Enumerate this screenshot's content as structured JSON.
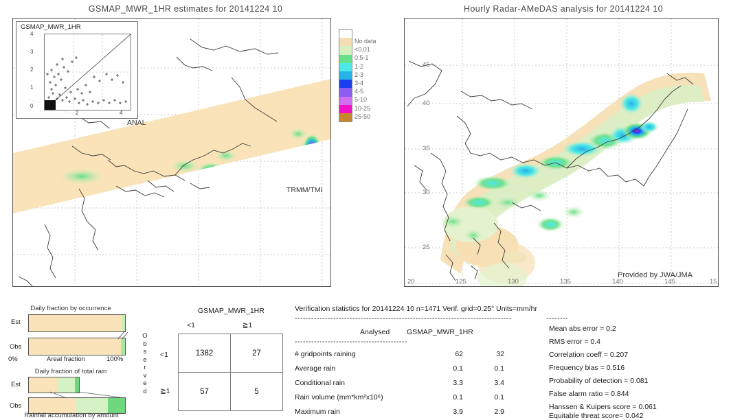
{
  "titles": {
    "left": "GSMAP_MWR_1HR estimates for 20141224 10",
    "right": "Hourly Radar-AMeDAS analysis for 20141224 10"
  },
  "left_map": {
    "inset_title": "GSMAP_MWR_1HR",
    "inset_y_ticks": [
      "4",
      "3",
      "2",
      "1",
      "0"
    ],
    "inset_x_ticks": [
      "2",
      "4"
    ],
    "anal_label": "ANAL",
    "trmm_label": "TRMM/TMI"
  },
  "right_map": {
    "lat_ticks": [
      "45",
      "40",
      "35",
      "30",
      "25",
      "20"
    ],
    "lon_ticks": [
      "125",
      "130",
      "135",
      "140",
      "145",
      "15"
    ],
    "credit": "Provided by JWA/JMA"
  },
  "colorbar": {
    "bands": [
      {
        "label": "",
        "color": "#ffffff"
      },
      {
        "label": "No data",
        "color": "#f5deb3"
      },
      {
        "label": "<0.01",
        "color": "#d6f0c0"
      },
      {
        "label": "0.5-1",
        "color": "#66e08a"
      },
      {
        "label": "1-2",
        "color": "#4de8e8"
      },
      {
        "label": "2-3",
        "color": "#26b3e8"
      },
      {
        "label": "3-4",
        "color": "#1a3ff0"
      },
      {
        "label": "4-5",
        "color": "#8a5cf0"
      },
      {
        "label": "5-10",
        "color": "#d070f0"
      },
      {
        "label": "10-25",
        "color": "#f010c8"
      },
      {
        "label": "25-50",
        "color": "#c8872e"
      }
    ]
  },
  "occurrence_chart": {
    "title": "Daily fraction by occurrence",
    "axis_label": "Areal fraction",
    "axis_min": "0%",
    "axis_max": "100%",
    "rows": [
      {
        "tag": "Est",
        "segments": [
          {
            "color": "#fae3b8",
            "pct": 96.2
          },
          {
            "color": "#c9f0b4",
            "pct": 3.8
          }
        ]
      },
      {
        "tag": "Obs",
        "segments": [
          {
            "color": "#fae3b8",
            "pct": 95.8
          },
          {
            "color": "#a8e8a0",
            "pct": 4.2
          }
        ]
      }
    ]
  },
  "amount_chart": {
    "title": "Daily fraction of total rain",
    "caption": "Rainfall accumulation by amount",
    "rows": [
      {
        "tag": "Est",
        "width_pct": 52,
        "segments": [
          {
            "color": "#fae3b8",
            "pct": 56
          },
          {
            "color": "#d5f2c4",
            "pct": 36
          },
          {
            "color": "#6ed87e",
            "pct": 8
          }
        ]
      },
      {
        "tag": "Obs",
        "width_pct": 100,
        "segments": [
          {
            "color": "#fae3b8",
            "pct": 49
          },
          {
            "color": "#d5f2c4",
            "pct": 33
          },
          {
            "color": "#6ed87e",
            "pct": 18
          }
        ]
      }
    ]
  },
  "contingency": {
    "title": "GSMAP_MWR_1HR",
    "col_headers": [
      "<1",
      "≧1"
    ],
    "row_headers": [
      "<1",
      "≧1"
    ],
    "observed_label": "Observed",
    "cells": [
      [
        "1382",
        "27"
      ],
      [
        "57",
        "5"
      ]
    ]
  },
  "verification": {
    "header": "Verification statistics for 20141224 10  n=1471  Verif. grid=0.25°  Units=mm/hr",
    "header_line1": "Verification statistics for 20141224 10  n=1471  Verif. grid=0.25°",
    "header_units": "Units=mm/hr",
    "col_headers": [
      "Analysed",
      "GSMAP_MWR_1HR"
    ],
    "rows": [
      {
        "label": "# gridpoints raining",
        "analysed": "62",
        "estimate": "32"
      },
      {
        "label": "Average rain",
        "analysed": "0.1",
        "estimate": "0.1"
      },
      {
        "label": "Conditional rain",
        "analysed": "3.3",
        "estimate": "3.4"
      },
      {
        "label": "Rain volume (mm*km²x10⁶)",
        "analysed": "0.1",
        "estimate": "0.1"
      },
      {
        "label": "Maximum rain",
        "analysed": "3.9",
        "estimate": "2.9"
      }
    ],
    "scores": [
      "Mean abs error = 0.2",
      "RMS error = 0.4",
      "Correlation coeff = 0.207",
      "Frequency bias = 0.516",
      "Probability of detection = 0.081",
      "False alarm ratio = 0.844",
      "Hanssen & Kuipers score = 0.061",
      "Equitable threat score= 0.042"
    ]
  }
}
